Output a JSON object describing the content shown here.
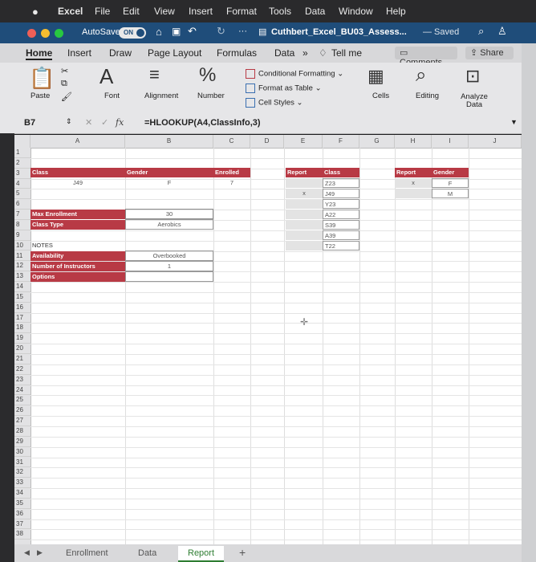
{
  "menubar": {
    "apple": "",
    "items": [
      "Excel",
      "File",
      "Edit",
      "View",
      "Insert",
      "Format",
      "Tools",
      "Data",
      "Window",
      "Help"
    ]
  },
  "titlebar": {
    "autosave_label": "AutoSave",
    "toggle": "ON",
    "more": "···",
    "filename": "Cuthbert_Excel_BU03_Assess...",
    "saved": "— Saved"
  },
  "ribbon_tabs": {
    "tabs": [
      "Home",
      "Insert",
      "Draw",
      "Page Layout",
      "Formulas",
      "Data",
      "»",
      "Tell me"
    ],
    "comments": "Comments",
    "share": "Share"
  },
  "ribbon": {
    "paste": "Paste",
    "font": "Font",
    "alignment": "Alignment",
    "number": "Number",
    "conditional_formatting": "Conditional Formatting",
    "format_as_table": "Format as Table",
    "cell_styles": "Cell Styles",
    "cells": "Cells",
    "editing": "Editing",
    "analyze_data": "Analyze Data"
  },
  "formula_bar": {
    "name_box": "B7",
    "fx": "fx",
    "formula": "=HLOOKUP(A4,ClassInfo,3)"
  },
  "columns": [
    "A",
    "B",
    "C",
    "D",
    "E",
    "F",
    "G",
    "H",
    "I",
    "J"
  ],
  "rows": [
    "1",
    "2",
    "3",
    "4",
    "5",
    "6",
    "7",
    "8",
    "9",
    "10",
    "11",
    "12",
    "13",
    "14",
    "15",
    "16",
    "17",
    "18",
    "19",
    "20",
    "21",
    "22",
    "23",
    "24",
    "25",
    "26",
    "27",
    "28",
    "29",
    "30",
    "31",
    "32",
    "33",
    "34",
    "35",
    "36",
    "37",
    "38"
  ],
  "cells": {
    "A3": "Class",
    "B3": "Gender",
    "C3": "Enrolled",
    "A4": "J49",
    "B4": "F",
    "C4": "7",
    "A7": "Max Enrollment",
    "B7": "30",
    "A8": "Class Type",
    "B8": "Aerobics",
    "A10": "NOTES",
    "A11": "Availability",
    "B11": "Overbooked",
    "A12": "Number of Instructors",
    "B12": "1",
    "A13": "Options",
    "E3": "Report",
    "F3": "Class",
    "E5": "x",
    "F_list": [
      "Z23",
      "J49",
      "Y23",
      "A22",
      "S39",
      "A39",
      "T22"
    ],
    "H3": "Report",
    "I3": "Gender",
    "H4": "x",
    "I4": "F",
    "I5": "M"
  },
  "sheet_tabs": [
    "Enrollment",
    "Data",
    "Report"
  ],
  "active_sheet": "Report",
  "add_sheet": "+",
  "colors": {
    "accent_red": "#b83a45",
    "title_blue": "#1f4d7a",
    "highlight_gray": "#e3e3e3"
  }
}
